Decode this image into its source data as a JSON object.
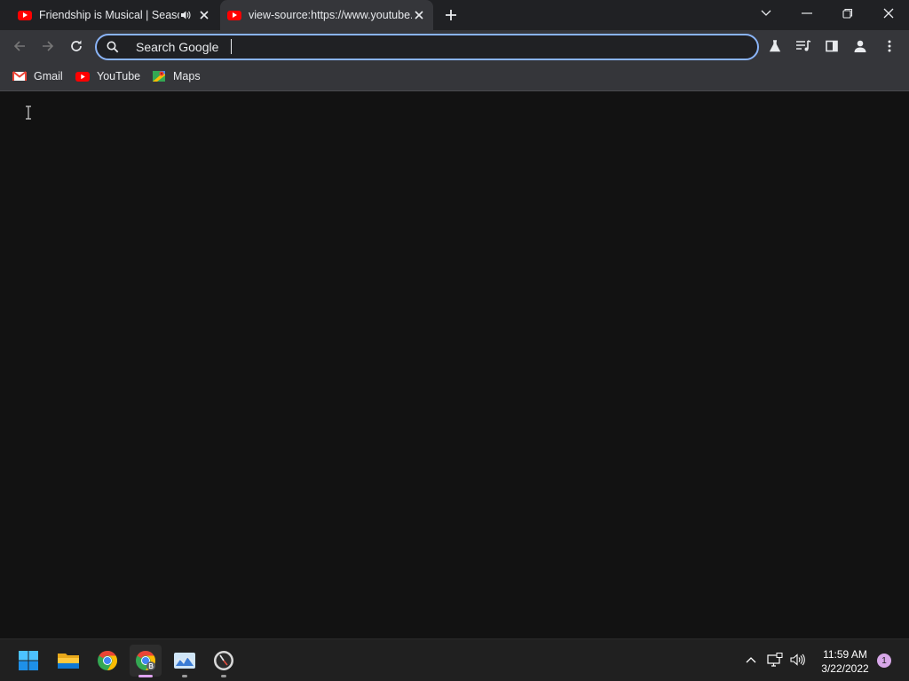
{
  "tabs": [
    {
      "title": "Friendship is Musical | Season",
      "favicon": "youtube-icon",
      "audio": true
    },
    {
      "title": "view-source:https://www.youtube.com",
      "favicon": "youtube-icon",
      "active": true
    }
  ],
  "omnibox": {
    "placeholder": "Search Google",
    "value": ""
  },
  "bookmarks": [
    {
      "label": "Gmail",
      "icon": "gmail-icon"
    },
    {
      "label": "YouTube",
      "icon": "youtube-icon"
    },
    {
      "label": "Maps",
      "icon": "maps-icon"
    }
  ],
  "toolbar_icons": [
    "back-icon",
    "forward-icon",
    "reload-icon",
    "labs-icon",
    "media-controls-icon",
    "side-panel-icon",
    "profile-icon",
    "menu-icon"
  ],
  "taskbar": {
    "apps": [
      "start-icon",
      "file-explorer-icon",
      "chrome-icon",
      "chrome-profile-icon",
      "photos-app-icon",
      "clock-app-icon"
    ],
    "time": "11:59 AM",
    "date": "3/22/2022",
    "notifications": "1"
  },
  "colors": {
    "accent": "#8ab4f8",
    "tabstrip": "#202124",
    "toolbar": "#35363a",
    "content": "#121212",
    "taskbar": "#202020"
  }
}
